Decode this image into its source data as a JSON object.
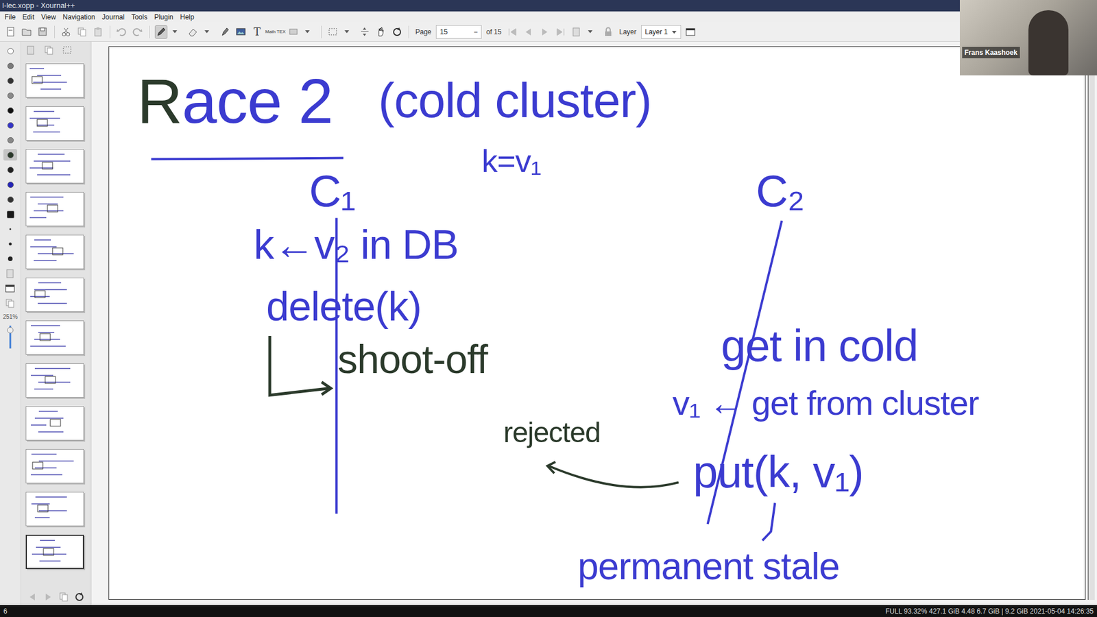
{
  "window": {
    "title": "l-lec.xopp - Xournal++"
  },
  "menu": [
    "File",
    "Edit",
    "View",
    "Navigation",
    "Journal",
    "Tools",
    "Plugin",
    "Help"
  ],
  "toolbar": {
    "pen_selected": true,
    "text_tool": "T",
    "math_tool": "Math TEX",
    "page_label": "Page",
    "page": "15",
    "zoom_out": "−",
    "page_count": "of 15",
    "layer_label": "Layer",
    "layer": "Layer 1"
  },
  "palette": [
    {
      "color": "#ffffff",
      "selected": false
    },
    {
      "color": "#7a7a7a",
      "selected": false
    },
    {
      "color": "#333333",
      "selected": false
    },
    {
      "color": "#8a8a8a",
      "selected": false
    },
    {
      "color": "#111111",
      "selected": false
    },
    {
      "color": "#3535c8",
      "selected": false
    },
    {
      "color": "#888888",
      "selected": false
    },
    {
      "color": "#2b3a2b",
      "selected": true
    },
    {
      "color": "#222222",
      "selected": false
    },
    {
      "color": "#2424b8",
      "selected": false
    },
    {
      "color": "#333333",
      "selected": false
    },
    {
      "color": "#1a1a1a",
      "selected": false
    }
  ],
  "zoom": "251%",
  "pages": [
    {
      "selected": false
    },
    {
      "selected": false
    },
    {
      "selected": false
    },
    {
      "selected": false
    },
    {
      "selected": false
    },
    {
      "selected": false
    },
    {
      "selected": false
    },
    {
      "selected": false
    },
    {
      "selected": false
    },
    {
      "selected": false
    },
    {
      "selected": false
    },
    {
      "selected": true
    }
  ],
  "canvas": {
    "title": "Race 2",
    "subtitle": "(cold cluster)",
    "initial": "k=v₁",
    "clients": [
      {
        "label": "C₁"
      },
      {
        "label": "C₂"
      }
    ],
    "notes": [
      {
        "text": "k←v₂ in DB",
        "color": "#3b3bd0"
      },
      {
        "text": "delete(k)",
        "color": "#3b3bd0"
      },
      {
        "text": "shoot-off",
        "color": "#2b3a2b"
      },
      {
        "text": "get in cold",
        "color": "#3b3bd0"
      },
      {
        "text": "v₁ ← get from cluster",
        "color": "#3b3bd0"
      },
      {
        "text": "put(k, v₁)",
        "color": "#3b3bd0"
      },
      {
        "text": "rejected",
        "color": "#2b3a2b"
      },
      {
        "text": "permanent stale",
        "color": "#3b3bd0"
      }
    ]
  },
  "webcam": {
    "name": "Frans Kaashoek"
  },
  "status_bar": {
    "left": "6",
    "right": "FULL 93.32% 427.1 GiB 4.48 6.7 GiB | 9.2 GiB 2021-05-04 14:26:35"
  }
}
